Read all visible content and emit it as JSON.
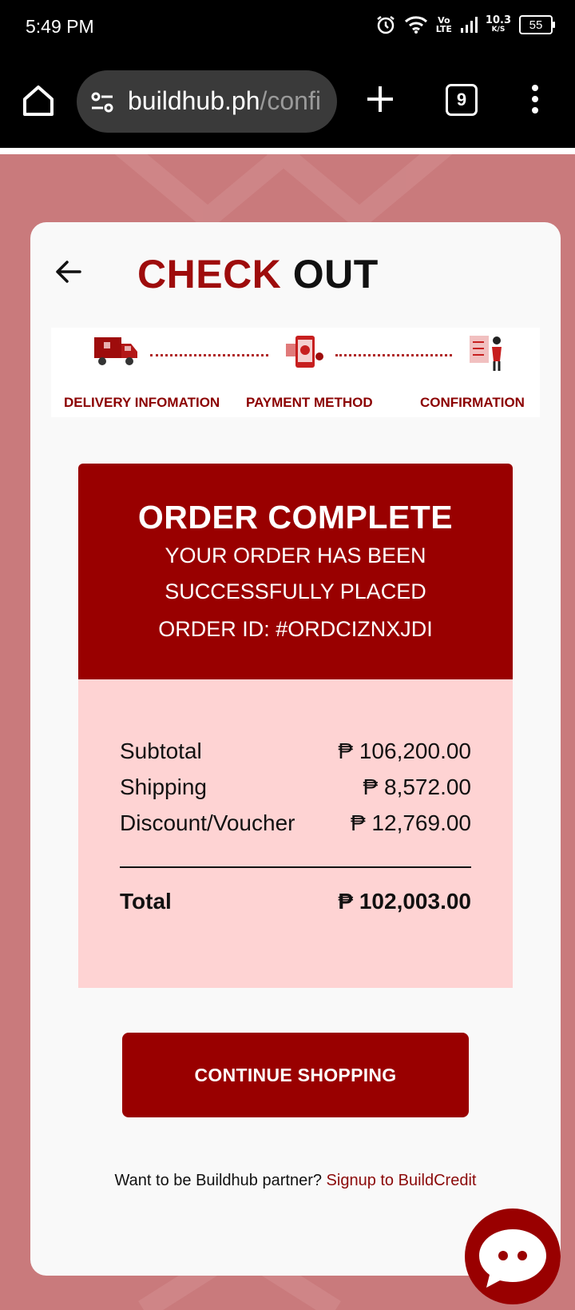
{
  "status_bar": {
    "time": "5:49 PM",
    "network_top": "Vo",
    "network_bottom": "LTE",
    "speed_value": "10.3",
    "speed_unit": "K/S",
    "battery": "55"
  },
  "browser": {
    "url_domain": "buildhub.ph",
    "url_path": "/confi",
    "tab_count": "9"
  },
  "checkout": {
    "title_part1": "CHECK",
    "title_part2": "OUT",
    "steps": [
      {
        "label": "DELIVERY INFOMATION",
        "icon": "delivery-truck-icon"
      },
      {
        "label": "PAYMENT METHOD",
        "icon": "payment-phone-icon"
      },
      {
        "label": "CONFIRMATION",
        "icon": "confirmation-checklist-icon"
      }
    ]
  },
  "order": {
    "title": "ORDER COMPLETE",
    "message": "YOUR ORDER HAS BEEN SUCCESSFULLY PLACED",
    "order_id": "ORDER ID: #ORDCIZNXJDI",
    "summary": {
      "subtotal_label": "Subtotal",
      "subtotal_value": "₱ 106,200.00",
      "shipping_label": "Shipping",
      "shipping_value": "₱ 8,572.00",
      "discount_label": "Discount/Voucher",
      "discount_value": "₱ 12,769.00",
      "total_label": "Total",
      "total_value": "₱ 102,003.00"
    }
  },
  "actions": {
    "continue_label": "CONTINUE SHOPPING",
    "partner_text": "Want to be Buildhub partner?",
    "partner_link": "Signup to BuildCredit"
  },
  "colors": {
    "brand": "#990000",
    "summary_bg": "#fed3d3",
    "page_bg": "#c97a7c"
  }
}
